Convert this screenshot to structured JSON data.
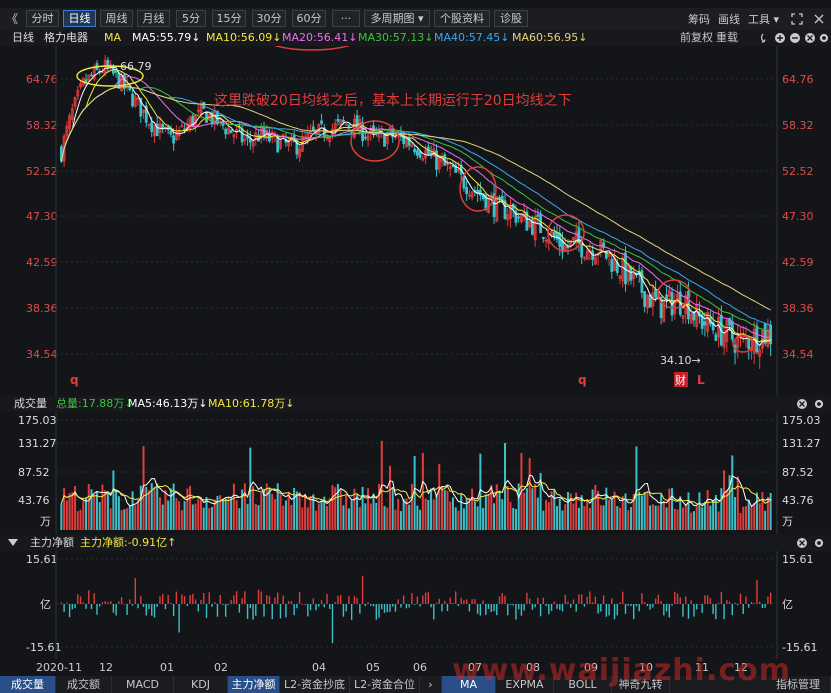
{
  "toolbar": {
    "back": "《",
    "items": [
      "分时",
      "日线",
      "周线",
      "月线",
      "5分",
      "15分",
      "30分",
      "60分",
      "···",
      "多周期图 ▾",
      "个股资料",
      "诊股"
    ],
    "right": [
      "筹码",
      "画线",
      "工具 ▾"
    ]
  },
  "ma_strip": {
    "period": "日线",
    "stock": "格力电器",
    "ind": "MA",
    "items": [
      {
        "label": "MA5:55.79↓",
        "color": "#ffffff"
      },
      {
        "label": "MA10:56.09↓",
        "color": "#f6e742"
      },
      {
        "label": "MA20:56.41↓",
        "color": "#ee71ee"
      },
      {
        "label": "MA30:57.13↓",
        "color": "#3cc43c"
      },
      {
        "label": "MA40:57.45↓",
        "color": "#3ca8ee"
      },
      {
        "label": "MA60:56.95↓",
        "color": "#e8d27a"
      }
    ],
    "right": [
      "前复权",
      "重载"
    ]
  },
  "price_axis": [
    "64.76",
    "58.32",
    "52.52",
    "47.30",
    "42.59",
    "38.36",
    "34.54"
  ],
  "annotations": {
    "text": "这里跌破20日均线之后，基本上长期运行于20日均线之下",
    "high": "66.79",
    "low": "34.10→",
    "q1": "q",
    "q2": "q",
    "cai": "财",
    "L": "L"
  },
  "vol_strip": {
    "title": "成交量",
    "total": "总量:17.88万↓",
    "ma5": "MA5:46.13万↓",
    "ma10": "MA10:61.78万↓"
  },
  "vol_axis": [
    "175.03",
    "131.27",
    "87.52",
    "43.76",
    "万"
  ],
  "flow_strip": {
    "title": "主力净额",
    "value": "主力净额:-0.91亿↑"
  },
  "flow_axis": [
    "15.61",
    "亿",
    "-15.61"
  ],
  "date_axis": [
    "2020-11",
    "12",
    "01",
    "02",
    "04",
    "05",
    "06",
    "07",
    "08",
    "09",
    "10",
    "11",
    "12"
  ],
  "tabs": [
    "成交量",
    "成交额",
    "MACD",
    "KDJ",
    "主力净额",
    "L2-资金抄底",
    "L2-资金合位",
    "MA",
    "EXPMA",
    "BOLL",
    "神奇九转",
    "指标管理"
  ],
  "watermark": "www.waijiazhi.com",
  "colors": {
    "up": "#e23c3c",
    "down": "#3ac1c9",
    "bg": "#131518"
  },
  "chart_data": [
    {
      "type": "candlestick",
      "title": "格力电器 日线",
      "y_ticks": [
        64.76,
        58.32,
        52.52,
        47.3,
        42.59,
        38.36,
        34.54
      ],
      "x_ticks": [
        "2020-11",
        "12",
        "01",
        "02",
        "04",
        "05",
        "06",
        "07",
        "08",
        "09",
        "10",
        "11",
        "12"
      ],
      "high": 66.79,
      "low": 34.1,
      "close_path": [
        [
          0,
          55
        ],
        [
          4,
          60
        ],
        [
          8,
          64
        ],
        [
          12,
          65.5
        ],
        [
          16,
          66.5
        ],
        [
          20,
          65
        ],
        [
          24,
          63
        ],
        [
          28,
          61
        ],
        [
          32,
          59
        ],
        [
          36,
          57.5
        ],
        [
          40,
          56.5
        ],
        [
          44,
          57.5
        ],
        [
          48,
          59
        ],
        [
          52,
          60
        ],
        [
          56,
          59
        ],
        [
          60,
          58
        ],
        [
          64,
          57
        ],
        [
          68,
          56
        ],
        [
          72,
          57
        ],
        [
          76,
          56.5
        ],
        [
          80,
          56
        ],
        [
          84,
          55.5
        ],
        [
          88,
          56
        ],
        [
          92,
          57
        ],
        [
          96,
          57.5
        ],
        [
          100,
          58
        ],
        [
          104,
          58.5
        ],
        [
          108,
          58
        ],
        [
          112,
          57
        ],
        [
          116,
          56.5
        ],
        [
          120,
          57
        ],
        [
          124,
          56.5
        ],
        [
          128,
          56
        ],
        [
          132,
          55
        ],
        [
          136,
          54
        ],
        [
          140,
          53
        ],
        [
          144,
          52
        ],
        [
          148,
          51
        ],
        [
          152,
          50
        ],
        [
          156,
          49
        ],
        [
          160,
          48
        ],
        [
          164,
          48
        ],
        [
          168,
          47
        ],
        [
          172,
          46.5
        ],
        [
          176,
          46
        ],
        [
          180,
          45
        ],
        [
          184,
          44
        ],
        [
          188,
          44.5
        ],
        [
          192,
          44
        ],
        [
          196,
          44
        ],
        [
          200,
          43
        ],
        [
          204,
          42
        ],
        [
          208,
          41
        ],
        [
          212,
          40
        ],
        [
          216,
          39
        ],
        [
          220,
          38.5
        ],
        [
          224,
          39
        ],
        [
          228,
          39
        ],
        [
          232,
          37.5
        ],
        [
          236,
          37
        ],
        [
          240,
          36.5
        ],
        [
          244,
          36
        ],
        [
          248,
          35.5
        ],
        [
          252,
          35.8
        ],
        [
          256,
          36.2
        ],
        [
          260,
          36
        ]
      ]
    }
  ]
}
